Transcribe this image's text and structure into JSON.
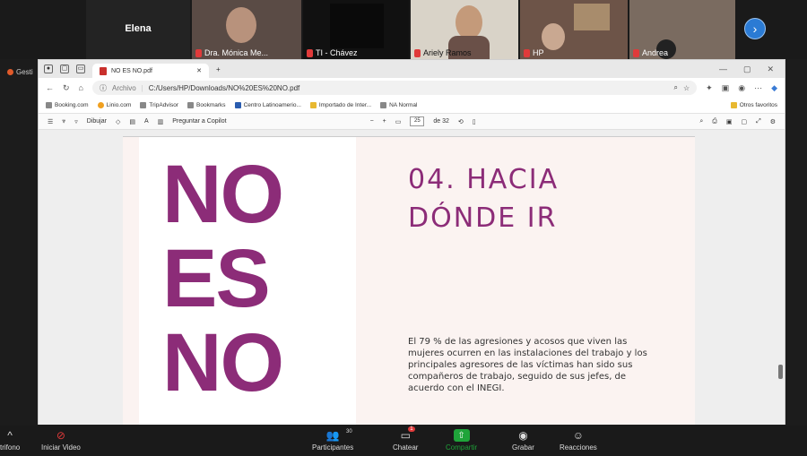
{
  "participants": [
    {
      "name": "Elena"
    },
    {
      "name": "Dra. Mónica Me..."
    },
    {
      "name": "TI - Chávez"
    },
    {
      "name": "Ariely Ramos"
    },
    {
      "name": "HP"
    },
    {
      "name": "Andrea"
    }
  ],
  "side_label": "Gesti",
  "browser": {
    "tab_title": "NO ES NO.pdf",
    "new_tab": "+",
    "address_prefix": "Archivo",
    "address": "C:/Users/HP/Downloads/NO%20ES%20NO.pdf",
    "bookmarks": [
      "Booking.com",
      "Linio.com",
      "TripAdvisor",
      "Bookmarks",
      "Centro Latinoamerio...",
      "Importado de Inter...",
      "NA Normal"
    ],
    "other_bookmarks": "Otros favoritos"
  },
  "pdf_toolbar": {
    "draw": "Dibujar",
    "copilot": "Preguntar a Copilot",
    "page_current": "25",
    "page_total": "de 32"
  },
  "pdf_page": {
    "poster_words": [
      "NO",
      "ES",
      "NO"
    ],
    "heading_line1": "04. HACIA",
    "heading_line2": "DÓNDE IR",
    "paragraph": "El 79 % de las agresiones y acosos que viven las mujeres ocurren en las instalaciones del trabajo y los principales agresores de las víctimas han sido sus compañeros de trabajo, seguido de sus jefes, de acuerdo con el INEGI."
  },
  "zoom_bar": {
    "left_cut": "trifono",
    "video": "Iniciar Video",
    "participants": "Participantes",
    "participants_count": "30",
    "chat": "Chatear",
    "chat_badge": "1",
    "share": "Compartir",
    "record": "Grabar",
    "reactions": "Reacciones"
  },
  "colors": {
    "accent": "#8c2c78",
    "share_green": "#1fa43a"
  }
}
